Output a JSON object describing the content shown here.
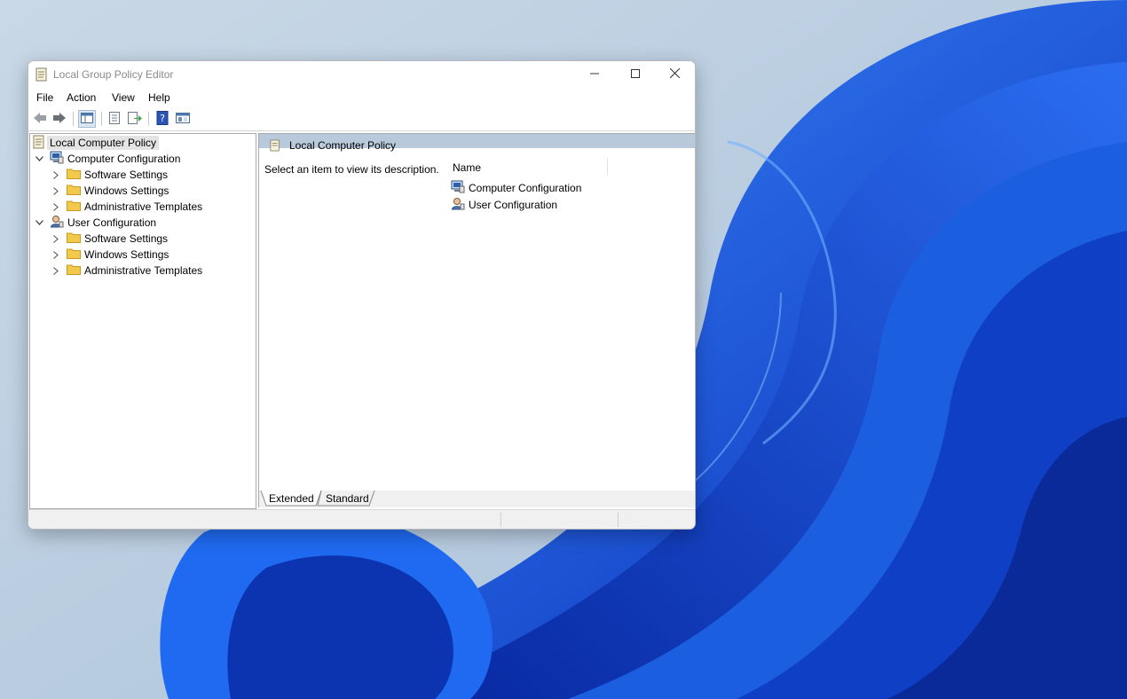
{
  "window": {
    "title": "Local Group Policy Editor",
    "controls": {
      "minimize": "minimize-icon",
      "maximize": "maximize-icon",
      "close": "close-icon"
    }
  },
  "menu": [
    "File",
    "Action",
    "View",
    "Help"
  ],
  "toolbar": {
    "buttons": [
      "back-arrow-icon",
      "forward-arrow-icon",
      "show-hide-tree-icon",
      "properties-icon",
      "export-list-icon",
      "help-icon",
      "console-view-icon"
    ]
  },
  "tree": {
    "root": "Local Computer Policy",
    "computer": {
      "label": "Computer Configuration",
      "children": [
        "Software Settings",
        "Windows Settings",
        "Administrative Templates"
      ]
    },
    "user": {
      "label": "User Configuration",
      "children": [
        "Software Settings",
        "Windows Settings",
        "Administrative Templates"
      ]
    }
  },
  "content": {
    "header": "Local Computer Policy",
    "description": "Select an item to view its description.",
    "column_name": "Name",
    "items": [
      "Computer Configuration",
      "User Configuration"
    ]
  },
  "tabs": {
    "extended": "Extended",
    "standard": "Standard"
  },
  "colors": {
    "accent_header": "#b8c9dc",
    "folder": "#f3c94c",
    "wallpaper_blue": "#1e5bd6"
  }
}
